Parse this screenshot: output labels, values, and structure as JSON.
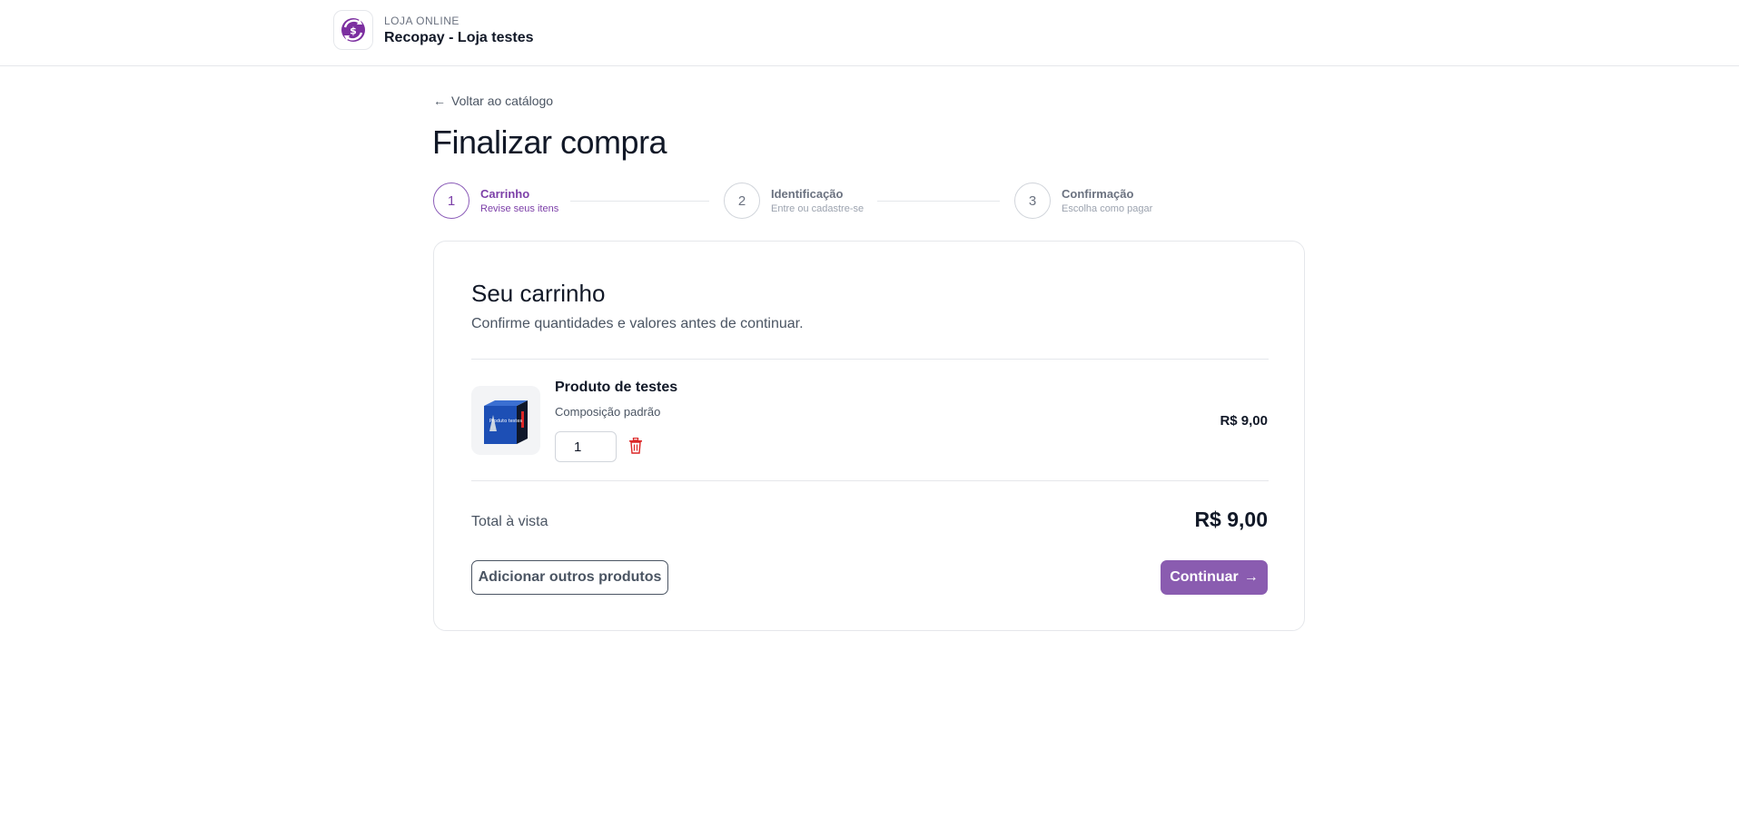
{
  "header": {
    "kicker": "LOJA ONLINE",
    "store_name": "Recopay - Loja testes",
    "logo_icon": "recopay-logo"
  },
  "nav": {
    "back_label": "Voltar ao catálogo"
  },
  "page": {
    "title": "Finalizar compra"
  },
  "stepper": {
    "steps": [
      {
        "number": "1",
        "title": "Carrinho",
        "subtitle": "Revise seus itens",
        "active": true
      },
      {
        "number": "2",
        "title": "Identificação",
        "subtitle": "Entre ou cadastre-se",
        "active": false
      },
      {
        "number": "3",
        "title": "Confirmação",
        "subtitle": "Escolha como pagar",
        "active": false
      }
    ]
  },
  "cart": {
    "title": "Seu carrinho",
    "subtitle": "Confirme quantidades e valores antes de continuar.",
    "items": [
      {
        "name": "Produto de testes",
        "description": "Composição padrão",
        "quantity": "1",
        "price": "R$ 9,00",
        "thumb_text": "Produto testes"
      }
    ],
    "total_label": "Total à vista",
    "total_value": "R$ 9,00",
    "add_more_label": "Adicionar outros produtos",
    "continue_label": "Continuar"
  },
  "colors": {
    "accent": "#8a5cb0",
    "accent_text": "#7c3fa8",
    "danger": "#dc2626"
  }
}
